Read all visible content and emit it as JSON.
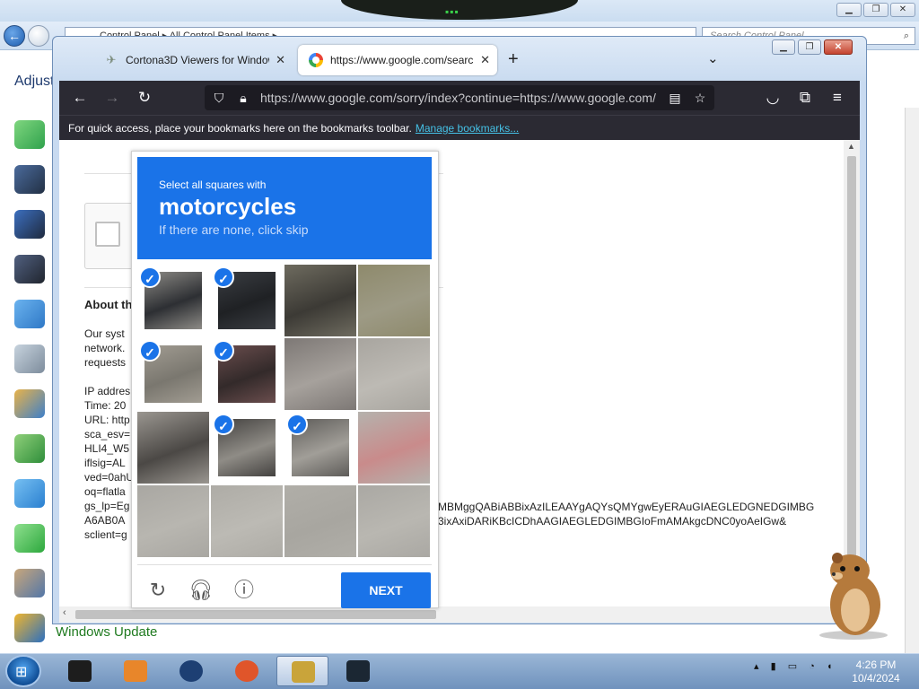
{
  "control_panel": {
    "breadcrumb": [
      "Control Panel",
      "All Control Panel Items"
    ],
    "search_placeholder": "Search Control Panel",
    "heading_fragment": "Adjust",
    "right_link_fragment": "s",
    "window_buttons": [
      "minimize",
      "maximize",
      "close"
    ],
    "windows_update_label": "Windows Update",
    "icons": [
      "transfer-icon",
      "keyboard-icon",
      "device-icon",
      "pc-icon",
      "network-icon",
      "display-icon",
      "users-icon",
      "recycle-icon",
      "globe-icon",
      "sync-icon",
      "people-icon",
      "windows-flag-icon"
    ]
  },
  "browser": {
    "tabs": [
      {
        "label": "Cortona3D Viewers for Window",
        "active": false
      },
      {
        "label": "https://www.google.com/search",
        "active": true
      }
    ],
    "url": "https://www.google.com/sorry/index?continue=https://www.google.com/",
    "bookmarks_message": "For quick access, place your bookmarks here on the bookmarks toolbar.",
    "bookmarks_link": "Manage bookmarks..."
  },
  "page": {
    "about_heading": "About th",
    "lines": [
      "Our syst",
      "network.",
      "requests",
      "",
      "IP addres",
      "Time: 20",
      "URL: http",
      "sca_esv=",
      "HLI4_W5",
      "iflsig=AL",
      "ved=0ahU",
      "oq=flatla",
      "gs_lp=Eg",
      "A6AB0A",
      "sclient=g"
    ],
    "url_line_1": "MBMggQABiABBixAzILEAAYgAQYsQMYgwEyERAuGIAEGLEDGNEDGIMBG",
    "url_line_2": "3ixAxiDARiKBcICDhAAGIAEGLEDGIMBGIoFmAMAkgcDNC0yoAeIGw&"
  },
  "captcha": {
    "instruction": "Select all squares with",
    "target": "motorcycles",
    "hint": "If there are none, click skip",
    "cells": [
      {
        "selected": true,
        "c1": "#8d8b86",
        "c2": "#2d2f33"
      },
      {
        "selected": true,
        "c1": "#3a3d42",
        "c2": "#1f2124"
      },
      {
        "selected": false,
        "c1": "#6e6b5f",
        "c2": "#3c3a35"
      },
      {
        "selected": false,
        "c1": "#8e8a6c",
        "c2": "#9d9a85"
      },
      {
        "selected": true,
        "c1": "#a19c92",
        "c2": "#7a776f"
      },
      {
        "selected": true,
        "c1": "#6a4d4d",
        "c2": "#332a2a"
      },
      {
        "selected": false,
        "c1": "#7d7875",
        "c2": "#a6a19c"
      },
      {
        "selected": false,
        "c1": "#a8a59f",
        "c2": "#bdbab4"
      },
      {
        "selected": false,
        "c1": "#9a9690",
        "c2": "#4b4845"
      },
      {
        "selected": true,
        "c1": "#444240",
        "c2": "#8f8c86"
      },
      {
        "selected": true,
        "c1": "#5e5c59",
        "c2": "#a19e98"
      },
      {
        "selected": false,
        "c1": "#b5b2ad",
        "c2": "#c98b8b"
      },
      {
        "selected": false,
        "c1": "#a9a7a2",
        "c2": "#b8b6b0"
      },
      {
        "selected": false,
        "c1": "#aeaca6",
        "c2": "#bcbab4"
      },
      {
        "selected": false,
        "c1": "#b0aea8",
        "c2": "#a8a6a0"
      },
      {
        "selected": false,
        "c1": "#aaa8a3",
        "c2": "#b9b7b1"
      }
    ],
    "reload_icon": "reload-icon",
    "audio_icon": "headphones-icon",
    "info_icon": "info-icon",
    "next_label": "NEXT",
    "accent": "#1a73e8"
  },
  "taskbar": {
    "time": "4:26 PM",
    "date": "10/4/2024",
    "items": [
      "terminal-icon",
      "media-player-icon",
      "globe-icon",
      "firefox-icon",
      "box-app-icon",
      "monitor-icon"
    ]
  }
}
